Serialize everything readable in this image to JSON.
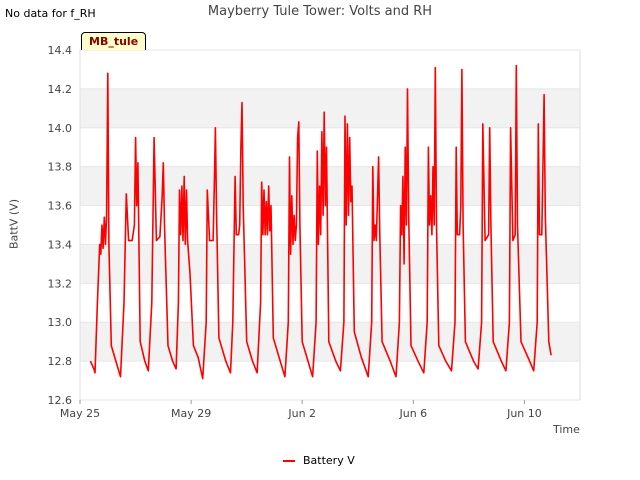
{
  "note": "No data for f_RH",
  "site_tag": "MB_tule",
  "chart_data": {
    "type": "line",
    "title": "Mayberry Tule Tower: Volts and RH",
    "xlabel": "Time",
    "ylabel": "BattV (V)",
    "ylim": [
      12.6,
      14.4
    ],
    "yticks": [
      "12.6",
      "12.8",
      "13.0",
      "13.2",
      "13.4",
      "13.6",
      "13.8",
      "14.0",
      "14.2",
      "14.4"
    ],
    "xticks": [
      "May 25",
      "May 29",
      "Jun 2",
      "Jun 6",
      "Jun 10"
    ],
    "x_domain": [
      "2024-05-25",
      "2024-06-12"
    ],
    "grid": true,
    "band_color": "#f2f2f2",
    "legend_position": "bottom-center",
    "series": [
      {
        "name": "Battery V",
        "color": "#ff0000",
        "points": [
          [
            "05-25 09:00",
            12.8
          ],
          [
            "05-25 12:00",
            12.76
          ],
          [
            "05-25 13:00",
            12.74
          ],
          [
            "05-25 15:00",
            13.1
          ],
          [
            "05-25 17:00",
            13.4
          ],
          [
            "05-25 18:00",
            13.35
          ],
          [
            "05-25 19:00",
            13.5
          ],
          [
            "05-25 20:00",
            13.38
          ],
          [
            "05-25 21:00",
            13.54
          ],
          [
            "05-25 22:00",
            13.4
          ],
          [
            "05-25 23:00",
            13.55
          ],
          [
            "05-26 00:00",
            14.28
          ],
          [
            "05-26 01:00",
            13.4
          ],
          [
            "05-26 03:00",
            12.88
          ],
          [
            "05-26 08:00",
            12.78
          ],
          [
            "05-26 11:00",
            12.72
          ],
          [
            "05-26 14:00",
            13.1
          ],
          [
            "05-26 16:00",
            13.66
          ],
          [
            "05-26 18:00",
            13.42
          ],
          [
            "05-26 21:00",
            13.42
          ],
          [
            "05-26 23:00",
            13.5
          ],
          [
            "05-27 00:00",
            13.95
          ],
          [
            "05-27 01:00",
            13.6
          ],
          [
            "05-27 02:00",
            13.82
          ],
          [
            "05-27 04:00",
            12.9
          ],
          [
            "05-27 08:00",
            12.8
          ],
          [
            "05-27 11:00",
            12.75
          ],
          [
            "05-27 14:00",
            13.1
          ],
          [
            "05-27 16:00",
            13.95
          ],
          [
            "05-27 18:00",
            13.42
          ],
          [
            "05-27 21:00",
            13.44
          ],
          [
            "05-27 23:00",
            13.65
          ],
          [
            "05-28 00:00",
            13.82
          ],
          [
            "05-28 01:00",
            13.5
          ],
          [
            "05-28 04:00",
            12.88
          ],
          [
            "05-28 08:00",
            12.8
          ],
          [
            "05-28 11:00",
            12.76
          ],
          [
            "05-28 13:00",
            13.1
          ],
          [
            "05-28 14:00",
            13.68
          ],
          [
            "05-28 15:00",
            13.45
          ],
          [
            "05-28 16:00",
            13.7
          ],
          [
            "05-28 17:00",
            13.42
          ],
          [
            "05-28 18:00",
            13.75
          ],
          [
            "05-28 19:00",
            13.4
          ],
          [
            "05-28 20:00",
            13.68
          ],
          [
            "05-28 21:00",
            13.42
          ],
          [
            "05-28 23:00",
            13.25
          ],
          [
            "05-29 02:00",
            12.88
          ],
          [
            "05-29 06:00",
            12.82
          ],
          [
            "05-29 10:00",
            12.71
          ],
          [
            "05-29 13:00",
            13.0
          ],
          [
            "05-29 14:00",
            13.68
          ],
          [
            "05-29 16:00",
            13.42
          ],
          [
            "05-29 19:00",
            13.42
          ],
          [
            "05-29 20:00",
            13.7
          ],
          [
            "05-29 21:00",
            14.0
          ],
          [
            "05-29 22:00",
            13.55
          ],
          [
            "05-30 00:00",
            12.92
          ],
          [
            "05-30 06:00",
            12.8
          ],
          [
            "05-30 10:00",
            12.74
          ],
          [
            "05-30 12:00",
            13.0
          ],
          [
            "05-30 14:00",
            13.75
          ],
          [
            "05-30 15:00",
            13.45
          ],
          [
            "05-30 17:00",
            13.45
          ],
          [
            "05-30 18:00",
            13.5
          ],
          [
            "05-30 19:00",
            13.9
          ],
          [
            "05-30 20:00",
            14.13
          ],
          [
            "05-30 21:00",
            13.6
          ],
          [
            "05-31 00:00",
            12.9
          ],
          [
            "05-31 05:00",
            12.8
          ],
          [
            "05-31 09:00",
            12.74
          ],
          [
            "05-31 12:00",
            13.1
          ],
          [
            "05-31 13:00",
            13.72
          ],
          [
            "05-31 14:00",
            13.45
          ],
          [
            "05-31 15:00",
            13.68
          ],
          [
            "05-31 16:00",
            13.45
          ],
          [
            "05-31 17:00",
            13.62
          ],
          [
            "05-31 18:00",
            13.45
          ],
          [
            "05-31 19:00",
            13.7
          ],
          [
            "05-31 20:00",
            13.47
          ],
          [
            "05-31 21:00",
            13.6
          ],
          [
            "05-31 23:00",
            12.92
          ],
          [
            "06-01 05:00",
            12.8
          ],
          [
            "06-01 09:00",
            12.72
          ],
          [
            "06-01 12:00",
            13.0
          ],
          [
            "06-01 13:00",
            13.85
          ],
          [
            "06-01 14:00",
            13.35
          ],
          [
            "06-01 15:00",
            13.65
          ],
          [
            "06-01 16:00",
            13.4
          ],
          [
            "06-01 17:00",
            13.55
          ],
          [
            "06-01 18:00",
            13.42
          ],
          [
            "06-01 19:00",
            13.5
          ],
          [
            "06-01 20:00",
            13.95
          ],
          [
            "06-01 21:00",
            14.03
          ],
          [
            "06-01 22:00",
            13.5
          ],
          [
            "06-02 00:00",
            12.9
          ],
          [
            "06-02 05:00",
            12.8
          ],
          [
            "06-02 09:00",
            12.72
          ],
          [
            "06-02 12:00",
            13.0
          ],
          [
            "06-02 13:00",
            13.88
          ],
          [
            "06-02 14:00",
            13.4
          ],
          [
            "06-02 15:00",
            13.7
          ],
          [
            "06-02 16:00",
            13.45
          ],
          [
            "06-02 17:00",
            13.98
          ],
          [
            "06-02 18:00",
            13.55
          ],
          [
            "06-02 19:00",
            14.08
          ],
          [
            "06-02 20:00",
            13.6
          ],
          [
            "06-02 21:00",
            13.9
          ],
          [
            "06-02 23:00",
            12.9
          ],
          [
            "06-03 05:00",
            12.8
          ],
          [
            "06-03 09:00",
            12.75
          ],
          [
            "06-03 12:00",
            13.0
          ],
          [
            "06-03 13:00",
            14.06
          ],
          [
            "06-03 14:00",
            13.5
          ],
          [
            "06-03 15:00",
            14.02
          ],
          [
            "06-03 16:00",
            13.55
          ],
          [
            "06-03 17:00",
            13.95
          ],
          [
            "06-03 18:00",
            13.62
          ],
          [
            "06-03 19:00",
            13.7
          ],
          [
            "06-03 21:00",
            12.95
          ],
          [
            "06-04 03:00",
            12.82
          ],
          [
            "06-04 09:00",
            12.72
          ],
          [
            "06-04 12:00",
            13.0
          ],
          [
            "06-04 13:00",
            13.8
          ],
          [
            "06-04 14:00",
            13.42
          ],
          [
            "06-04 15:00",
            13.5
          ],
          [
            "06-04 16:00",
            13.42
          ],
          [
            "06-04 18:00",
            13.85
          ],
          [
            "06-04 19:00",
            13.45
          ],
          [
            "06-04 21:00",
            12.9
          ],
          [
            "06-05 04:00",
            12.8
          ],
          [
            "06-05 09:00",
            12.72
          ],
          [
            "06-05 12:00",
            13.0
          ],
          [
            "06-05 13:00",
            13.6
          ],
          [
            "06-05 14:00",
            13.45
          ],
          [
            "06-05 15:00",
            13.75
          ],
          [
            "06-05 16:00",
            13.3
          ],
          [
            "06-05 17:00",
            13.9
          ],
          [
            "06-05 18:00",
            13.5
          ],
          [
            "06-05 19:00",
            14.2
          ],
          [
            "06-05 20:00",
            13.55
          ],
          [
            "06-05 22:00",
            12.88
          ],
          [
            "06-06 04:00",
            12.8
          ],
          [
            "06-06 09:00",
            12.74
          ],
          [
            "06-06 12:00",
            13.0
          ],
          [
            "06-06 13:00",
            13.9
          ],
          [
            "06-06 14:00",
            13.5
          ],
          [
            "06-06 15:00",
            13.65
          ],
          [
            "06-06 16:00",
            13.45
          ],
          [
            "06-06 17:00",
            13.8
          ],
          [
            "06-06 18:00",
            13.5
          ],
          [
            "06-06 19:00",
            14.31
          ],
          [
            "06-06 20:00",
            13.5
          ],
          [
            "06-06 22:00",
            12.88
          ],
          [
            "06-07 04:00",
            12.8
          ],
          [
            "06-07 09:00",
            12.75
          ],
          [
            "06-07 12:00",
            13.0
          ],
          [
            "06-07 13:00",
            13.9
          ],
          [
            "06-07 14:00",
            13.45
          ],
          [
            "06-07 16:00",
            13.45
          ],
          [
            "06-07 17:00",
            13.6
          ],
          [
            "06-07 18:00",
            14.3
          ],
          [
            "06-07 19:00",
            13.5
          ],
          [
            "06-07 21:00",
            12.9
          ],
          [
            "06-08 04:00",
            12.8
          ],
          [
            "06-08 08:00",
            12.76
          ],
          [
            "06-08 11:00",
            13.0
          ],
          [
            "06-08 12:00",
            14.02
          ],
          [
            "06-08 14:00",
            13.42
          ],
          [
            "06-08 17:00",
            13.45
          ],
          [
            "06-08 18:00",
            14.0
          ],
          [
            "06-08 19:00",
            13.5
          ],
          [
            "06-08 21:00",
            12.9
          ],
          [
            "06-09 04:00",
            12.8
          ],
          [
            "06-09 08:00",
            12.75
          ],
          [
            "06-09 11:00",
            13.0
          ],
          [
            "06-09 12:00",
            14.0
          ],
          [
            "06-09 14:00",
            13.42
          ],
          [
            "06-09 16:00",
            13.45
          ],
          [
            "06-09 17:00",
            14.32
          ],
          [
            "06-09 18:00",
            13.5
          ],
          [
            "06-09 21:00",
            12.9
          ],
          [
            "06-10 03:00",
            12.82
          ],
          [
            "06-10 08:00",
            12.75
          ],
          [
            "06-10 11:00",
            13.0
          ],
          [
            "06-10 12:00",
            14.02
          ],
          [
            "06-10 13:00",
            13.45
          ],
          [
            "06-10 15:00",
            13.45
          ],
          [
            "06-10 17:00",
            14.17
          ],
          [
            "06-10 18:00",
            13.55
          ],
          [
            "06-10 21:00",
            12.9
          ],
          [
            "06-10 23:00",
            12.83
          ]
        ]
      }
    ]
  }
}
